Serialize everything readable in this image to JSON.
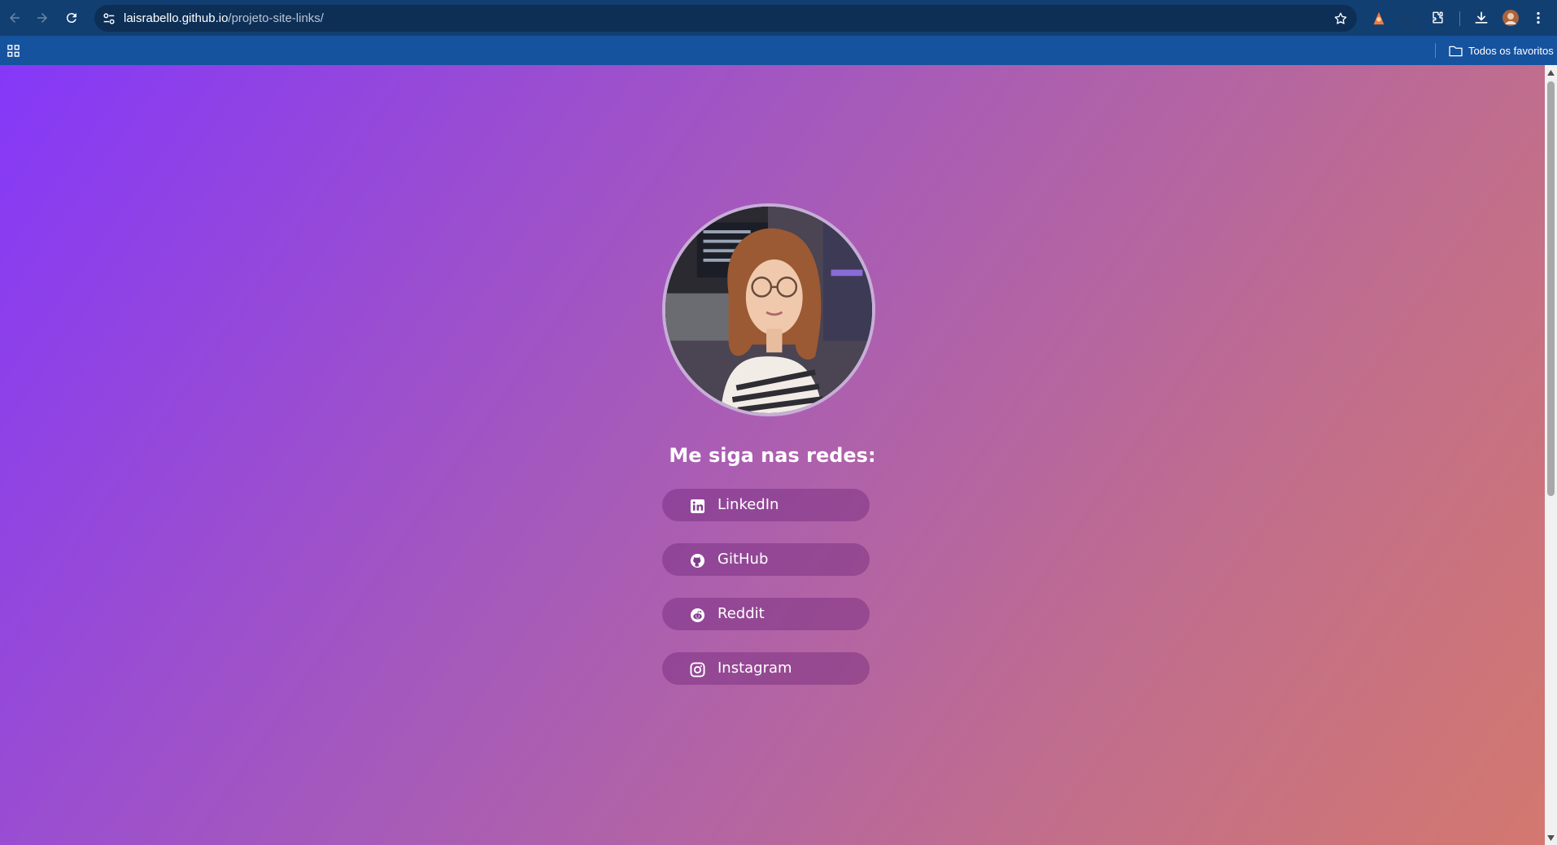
{
  "browser": {
    "url_host": "laisrabello.github.io",
    "url_path": "/projeto-site-links/",
    "bookmarks_folder_label": "Todos os favoritos"
  },
  "page": {
    "heading": "Me siga nas redes:",
    "links": [
      {
        "label": "LinkedIn",
        "icon": "linkedin-icon"
      },
      {
        "label": "GitHub",
        "icon": "github-icon"
      },
      {
        "label": "Reddit",
        "icon": "reddit-icon"
      },
      {
        "label": "Instagram",
        "icon": "instagram-icon"
      }
    ]
  },
  "colors": {
    "toolbar": "#123f71",
    "bookmarks_bar": "#16539e",
    "gradient_start": "#8538f8",
    "gradient_end": "#d3786f",
    "button_fill": "rgba(110,35,120,0.42)"
  }
}
